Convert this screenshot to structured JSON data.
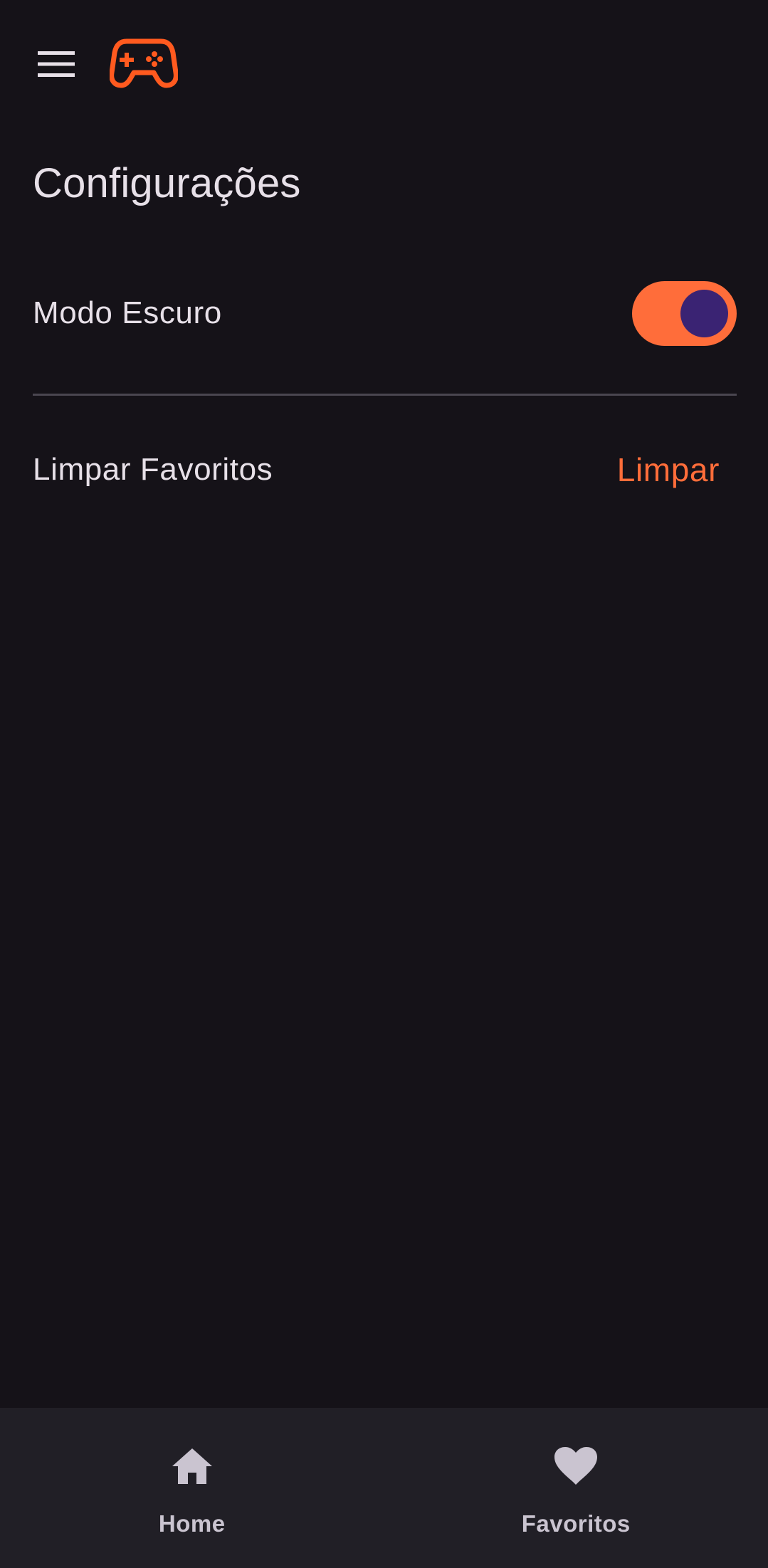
{
  "app_bar": {
    "menu_icon": "hamburger-menu-icon",
    "logo_icon": "gamepad-icon"
  },
  "page": {
    "title": "Configurações"
  },
  "settings": {
    "dark_mode": {
      "label": "Modo Escuro",
      "enabled": true
    },
    "clear_favorites": {
      "label": "Limpar Favoritos",
      "action_label": "Limpar"
    }
  },
  "bottom_nav": {
    "items": [
      {
        "label": "Home",
        "icon": "home-icon"
      },
      {
        "label": "Favoritos",
        "icon": "heart-icon"
      }
    ]
  },
  "colors": {
    "background": "#151218",
    "accent": "#ff6d3a",
    "logo": "#ff5a1f",
    "switch_thumb": "#3a2373",
    "nav_background": "#211f26",
    "nav_foreground": "#cac4d0",
    "text": "#e7e0e8"
  }
}
